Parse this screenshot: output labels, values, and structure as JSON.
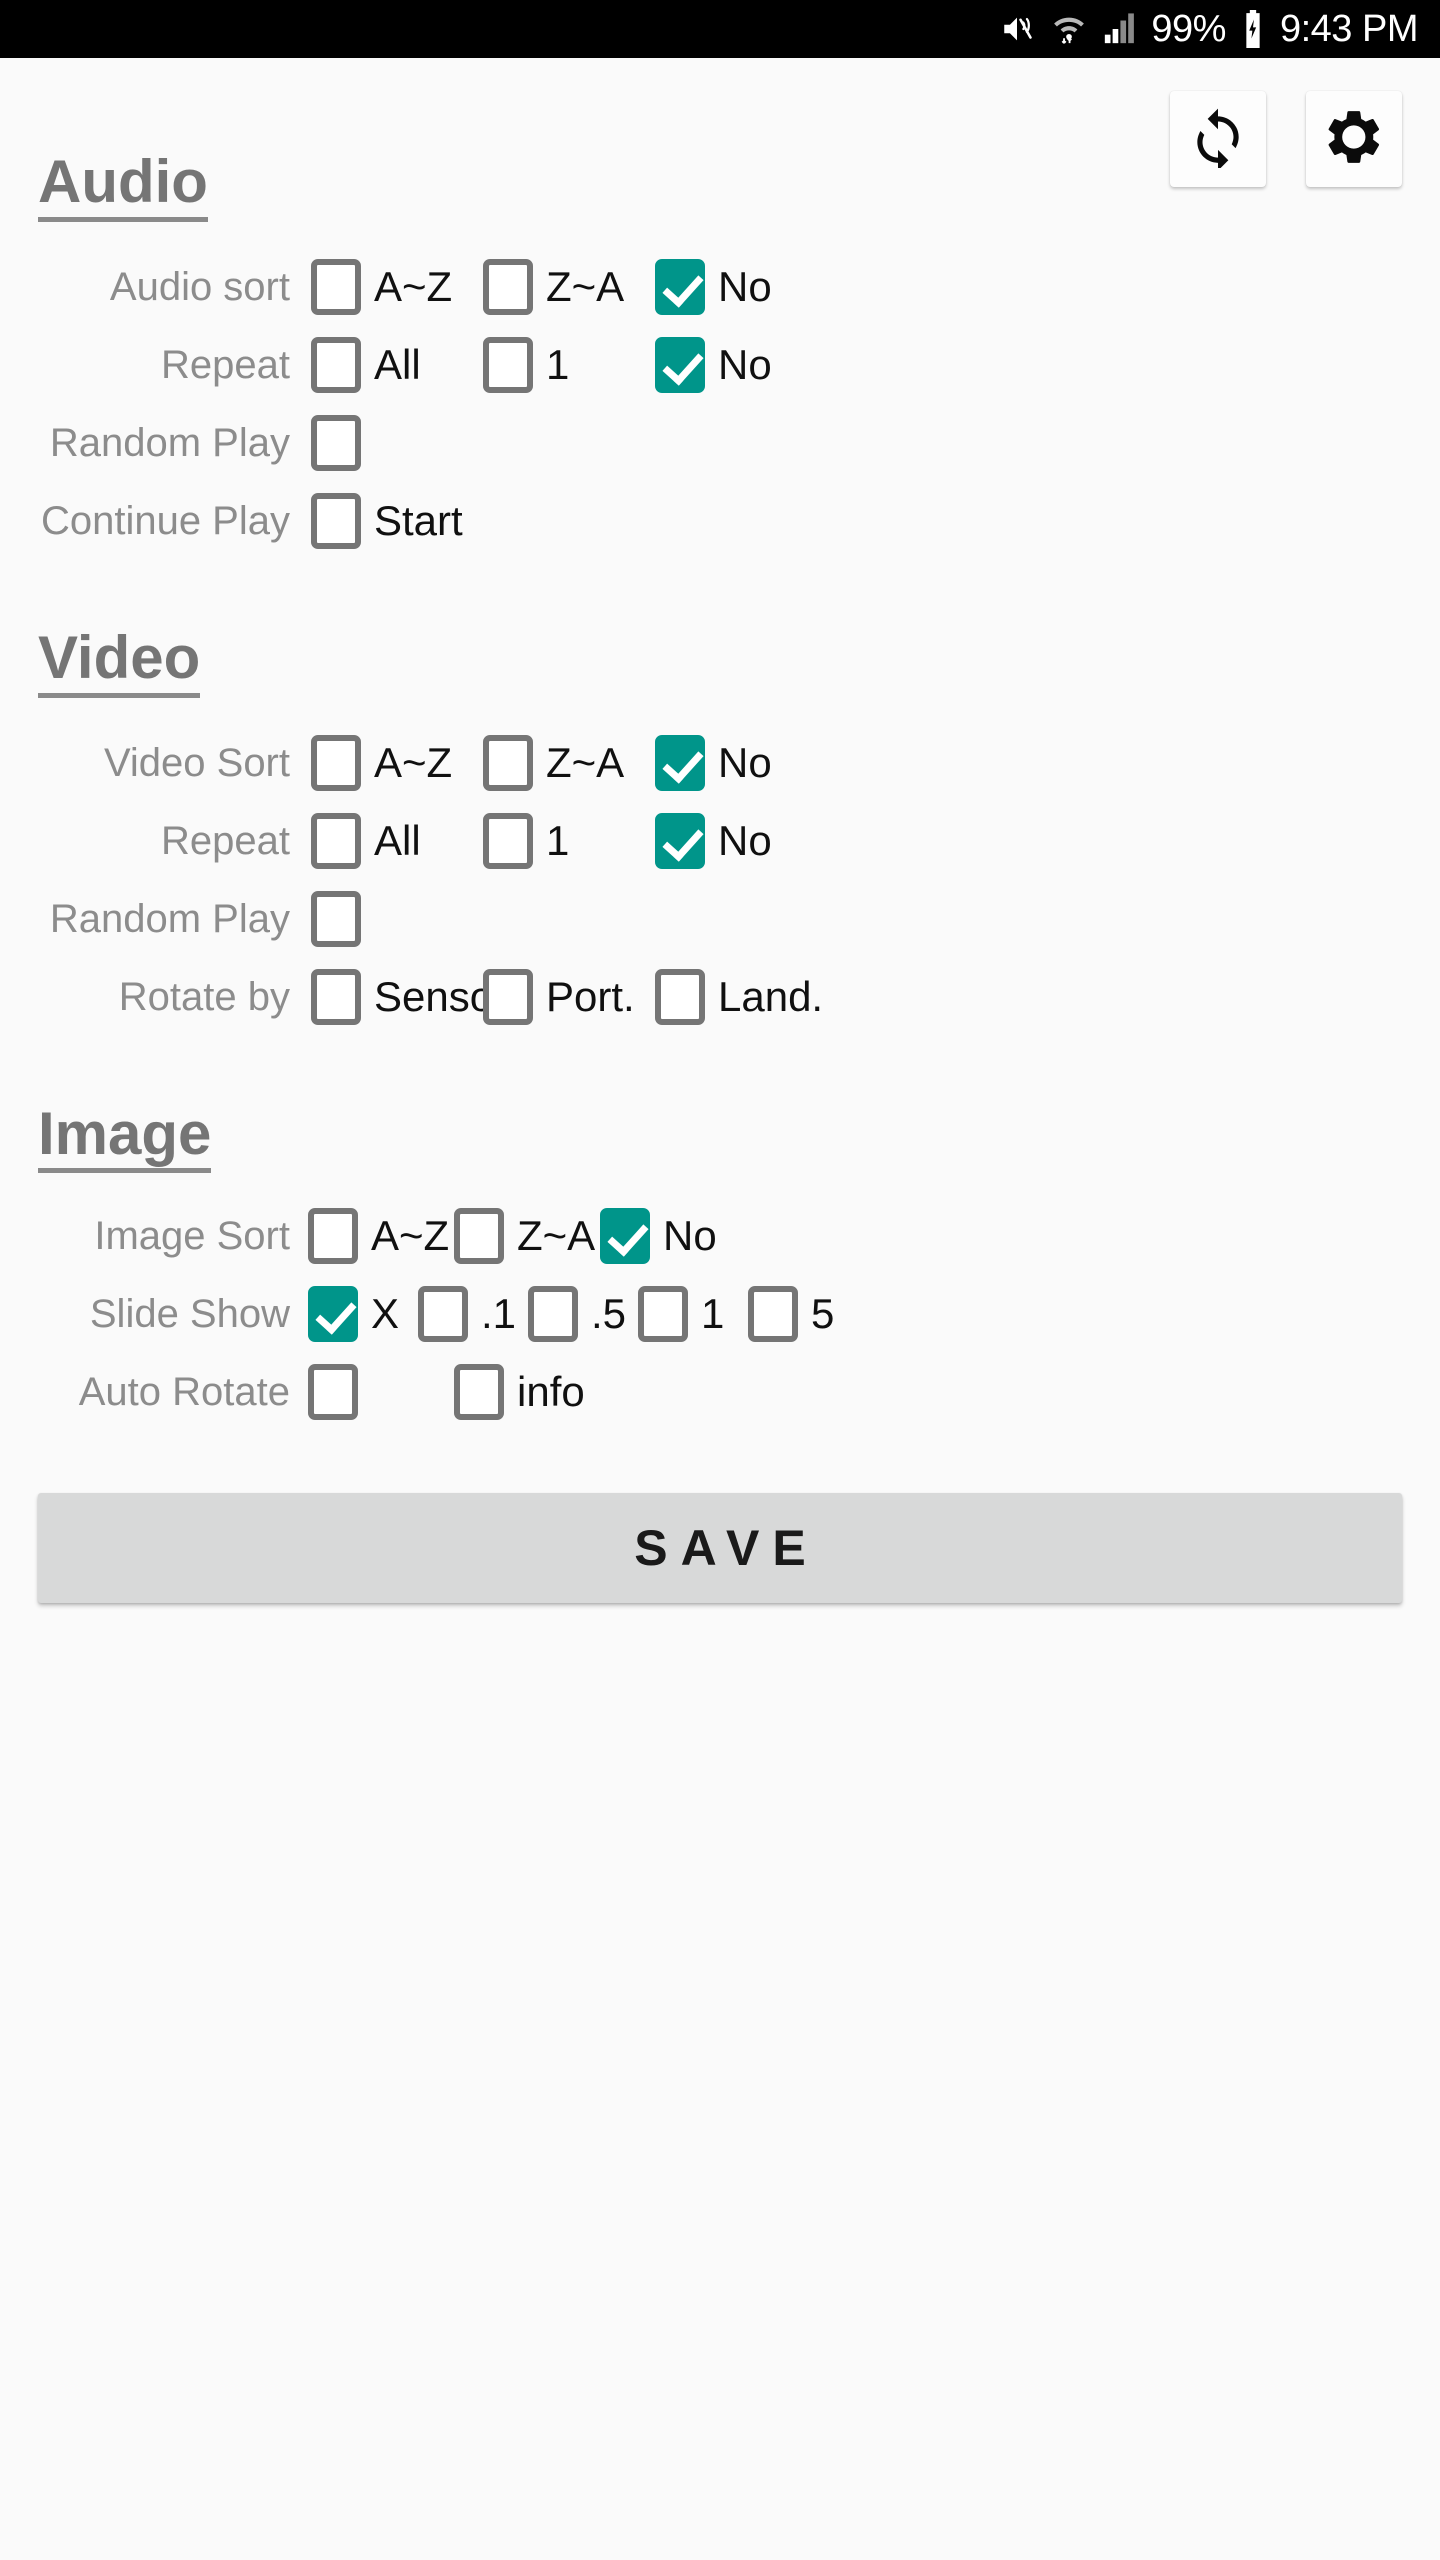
{
  "statusbar": {
    "battery_percent": "99%",
    "time": "9:43 PM",
    "icons": [
      "volume-mute-icon",
      "wifi-icon",
      "cellular-signal-icon",
      "battery-charging-icon"
    ]
  },
  "top_actions": [
    {
      "name": "refresh-button",
      "icon": "refresh-icon"
    },
    {
      "name": "settings-button",
      "icon": "gear-icon"
    }
  ],
  "colors": {
    "accent_checked": "#00958a",
    "checkbox_border": "#757575",
    "heading": "#757575",
    "row_label": "#8c8c8c",
    "background": "#fafafa",
    "save_button": "#d8d9d9"
  },
  "sections": [
    {
      "title": "Audio",
      "rows": [
        {
          "label": "Audio sort",
          "options": [
            {
              "label": "A~Z",
              "checked": false
            },
            {
              "label": "Z~A",
              "checked": false
            },
            {
              "label": "No",
              "checked": true
            }
          ]
        },
        {
          "label": "Repeat",
          "options": [
            {
              "label": "All",
              "checked": false
            },
            {
              "label": "1",
              "checked": false
            },
            {
              "label": "No",
              "checked": true
            }
          ]
        },
        {
          "label": "Random Play",
          "options": [
            {
              "label": "",
              "checked": false
            }
          ]
        },
        {
          "label": "Continue Play",
          "options": [
            {
              "label": "Start",
              "checked": false
            }
          ]
        }
      ]
    },
    {
      "title": "Video",
      "rows": [
        {
          "label": "Video Sort",
          "options": [
            {
              "label": "A~Z",
              "checked": false
            },
            {
              "label": "Z~A",
              "checked": false
            },
            {
              "label": "No",
              "checked": true
            }
          ]
        },
        {
          "label": "Repeat",
          "options": [
            {
              "label": "All",
              "checked": false
            },
            {
              "label": "1",
              "checked": false
            },
            {
              "label": "No",
              "checked": true
            }
          ]
        },
        {
          "label": "Random Play",
          "options": [
            {
              "label": "",
              "checked": false
            }
          ]
        },
        {
          "label": "Rotate by",
          "options": [
            {
              "label": "Sensor",
              "checked": false
            },
            {
              "label": "Port.",
              "checked": false
            },
            {
              "label": "Land.",
              "checked": false
            }
          ]
        }
      ]
    },
    {
      "title": "Image",
      "rows": [
        {
          "label": "Image Sort",
          "options": [
            {
              "label": "A~Z",
              "checked": false
            },
            {
              "label": "Z~A",
              "checked": false
            },
            {
              "label": "No",
              "checked": true
            }
          ]
        },
        {
          "label": "Slide Show",
          "options": [
            {
              "label": "X",
              "checked": true
            },
            {
              "label": ".1",
              "checked": false
            },
            {
              "label": ".5",
              "checked": false
            },
            {
              "label": "1",
              "checked": false
            },
            {
              "label": "5",
              "checked": false
            }
          ]
        },
        {
          "label": "Auto Rotate",
          "options": [
            {
              "label": "",
              "checked": false
            },
            {
              "label": "info",
              "checked": false
            }
          ]
        }
      ]
    }
  ],
  "save": {
    "label": "SAVE"
  }
}
